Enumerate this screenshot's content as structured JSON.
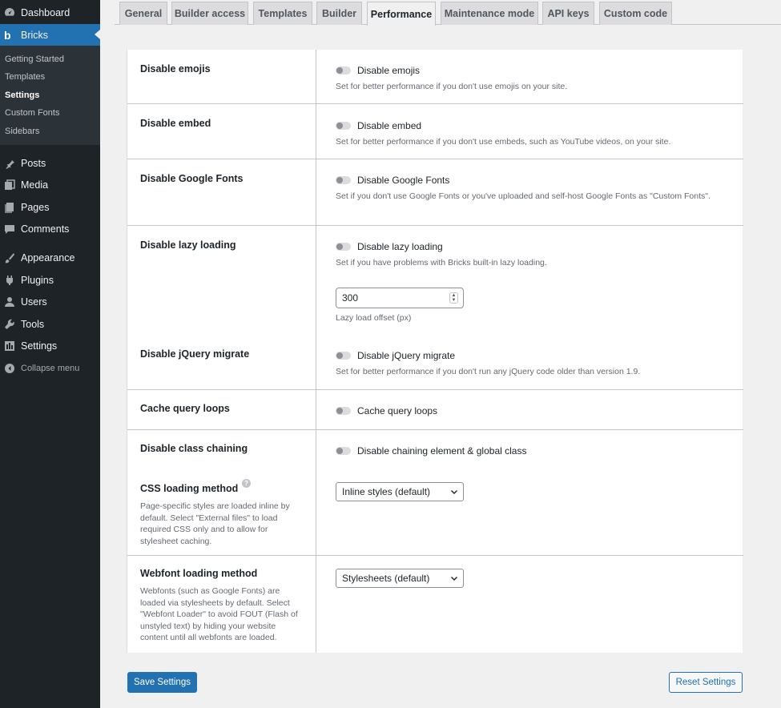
{
  "sidebar": {
    "menu": [
      {
        "label": "Dashboard",
        "icon": "dashboard-icon"
      },
      {
        "label": "Bricks",
        "icon": "bricks-logo-icon"
      },
      {
        "label": "Posts",
        "icon": "pin-icon"
      },
      {
        "label": "Media",
        "icon": "media-icon"
      },
      {
        "label": "Pages",
        "icon": "pages-icon"
      },
      {
        "label": "Comments",
        "icon": "comment-icon"
      },
      {
        "label": "Appearance",
        "icon": "paintbrush-icon"
      },
      {
        "label": "Plugins",
        "icon": "plug-icon"
      },
      {
        "label": "Users",
        "icon": "user-icon"
      },
      {
        "label": "Tools",
        "icon": "wrench-icon"
      },
      {
        "label": "Settings",
        "icon": "settings-icon"
      }
    ],
    "submenu": [
      "Getting Started",
      "Templates",
      "Settings",
      "Custom Fonts",
      "Sidebars"
    ],
    "bricks_logo_letter": "b",
    "collapse_label": "Collapse menu"
  },
  "tabs": [
    "General",
    "Builder access",
    "Templates",
    "Builder",
    "Performance",
    "Maintenance mode",
    "API keys",
    "Custom code"
  ],
  "rows": {
    "emojis": {
      "label": "Disable emojis",
      "toggle": "Disable emojis",
      "desc": "Set for better performance if you don't use emojis on your site."
    },
    "embed": {
      "label": "Disable embed",
      "toggle": "Disable embed",
      "desc": "Set for better performance if you don't use embeds, such as YouTube videos, on your site."
    },
    "google_fonts": {
      "label": "Disable Google Fonts",
      "toggle": "Disable Google Fonts",
      "desc": "Set if you don't use Google Fonts or you've uploaded and self-host Google Fonts as \"Custom Fonts\"."
    },
    "lazy": {
      "label": "Disable lazy loading",
      "toggle": "Disable lazy loading",
      "desc": "Set if you have problems with Bricks built-in lazy loading.",
      "offset_value": "300",
      "offset_label": "Lazy load offset (px)"
    },
    "jquery": {
      "label": "Disable jQuery migrate",
      "toggle": "Disable jQuery migrate",
      "desc": "Set for better performance if you don't run any jQuery code older than version 1.9."
    },
    "cache": {
      "label": "Cache query loops",
      "toggle": "Cache query loops"
    },
    "chaining": {
      "label": "Disable class chaining",
      "toggle": "Disable chaining element & global class"
    },
    "css": {
      "label": "CSS loading method",
      "help": "?",
      "desc": "Page-specific styles are loaded inline by default. Select \"External files\" to load required CSS only and to allow for stylesheet caching.",
      "selected": "Inline styles (default)"
    },
    "webfont": {
      "label": "Webfont loading method",
      "desc": "Webfonts (such as Google Fonts) are loaded via stylesheets by default. Select \"Webfont Loader\" to avoid FOUT (Flash of unstyled text) by hiding your website content until all webfonts are loaded.",
      "selected": "Stylesheets (default)"
    }
  },
  "buttons": {
    "save": "Save Settings",
    "reset": "Reset Settings"
  },
  "colors": {
    "sidebar_bg": "#1d2327",
    "accent": "#2271b1",
    "page_bg": "#f0f0f1"
  }
}
